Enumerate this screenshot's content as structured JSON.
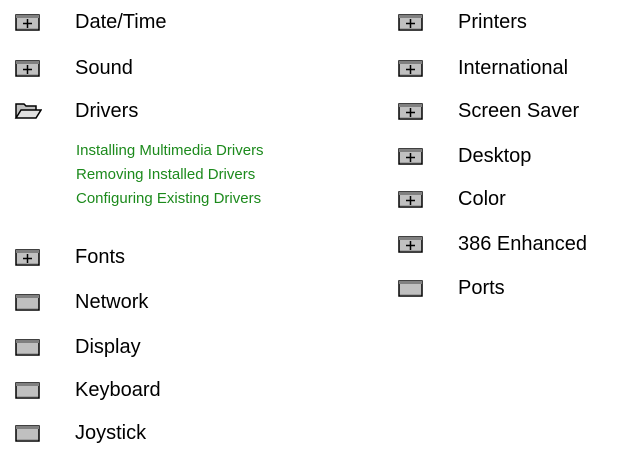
{
  "left_items": [
    {
      "label": "Date/Time",
      "icon": "closed-book-icon"
    },
    {
      "label": "Sound",
      "icon": "closed-book-icon"
    },
    {
      "label": "Drivers",
      "icon": "open-book-icon"
    },
    {
      "label": "Fonts",
      "icon": "closed-book-icon"
    },
    {
      "label": "Network",
      "icon": "page-icon"
    },
    {
      "label": "Display",
      "icon": "page-icon"
    },
    {
      "label": "Keyboard",
      "icon": "page-icon"
    },
    {
      "label": "Joystick",
      "icon": "page-icon"
    }
  ],
  "driver_topics": [
    "Installing Multimedia Drivers",
    "Removing Installed Drivers",
    "Configuring Existing Drivers"
  ],
  "right_items": [
    {
      "label": "Printers",
      "icon": "closed-book-icon"
    },
    {
      "label": "International",
      "icon": "closed-book-icon"
    },
    {
      "label": "Screen Saver",
      "icon": "closed-book-icon"
    },
    {
      "label": "Desktop",
      "icon": "closed-book-icon"
    },
    {
      "label": "Color",
      "icon": "closed-book-icon"
    },
    {
      "label": "386 Enhanced",
      "icon": "closed-book-icon"
    },
    {
      "label": "Ports",
      "icon": "page-icon"
    }
  ],
  "colors": {
    "text": "#000000",
    "topic_link": "#1c8a1c",
    "background": "#ffffff"
  }
}
